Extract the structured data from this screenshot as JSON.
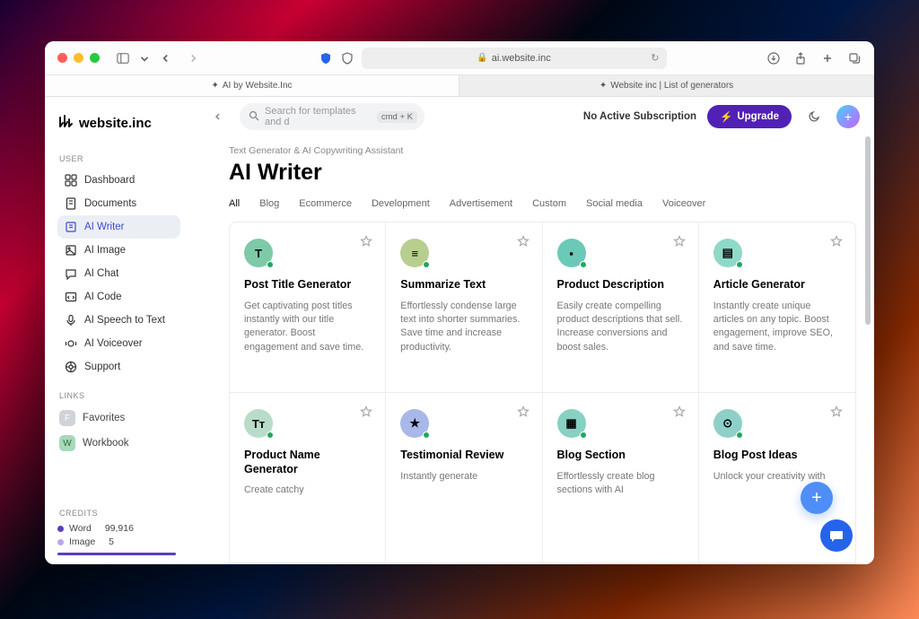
{
  "browser": {
    "url": "ai.website.inc",
    "tabs": [
      {
        "label": "AI by Website.Inc",
        "active": true
      },
      {
        "label": "Website inc | List of generators",
        "active": false
      }
    ]
  },
  "header": {
    "logo": "website.inc",
    "search_placeholder": "Search for templates and d",
    "search_kbd": "cmd + K",
    "subscription": "No Active Subscription",
    "upgrade": "Upgrade"
  },
  "sidebar": {
    "sections": {
      "user_label": "USER",
      "links_label": "LINKS",
      "credits_label": "CREDITS"
    },
    "user": [
      {
        "label": "Dashboard",
        "icon": "grid"
      },
      {
        "label": "Documents",
        "icon": "doc"
      },
      {
        "label": "AI Writer",
        "icon": "writer",
        "active": true
      },
      {
        "label": "AI Image",
        "icon": "image"
      },
      {
        "label": "AI Chat",
        "icon": "chat"
      },
      {
        "label": "AI Code",
        "icon": "code"
      },
      {
        "label": "AI Speech to Text",
        "icon": "mic"
      },
      {
        "label": "AI Voiceover",
        "icon": "voice"
      },
      {
        "label": "Support",
        "icon": "support"
      }
    ],
    "links": [
      {
        "label": "Favorites",
        "badge": "F"
      },
      {
        "label": "Workbook",
        "badge": "W"
      }
    ],
    "credits": [
      {
        "label": "Word",
        "value": "99,916",
        "color": "purple"
      },
      {
        "label": "Image",
        "value": "5",
        "color": "lav"
      }
    ]
  },
  "page": {
    "breadcrumb": "Text Generator & AI Copywriting Assistant",
    "title": "AI Writer",
    "filters": [
      "All",
      "Blog",
      "Ecommerce",
      "Development",
      "Advertisement",
      "Custom",
      "Social media",
      "Voiceover"
    ],
    "active_filter": "All",
    "cards": [
      {
        "title": "Post Title Generator",
        "desc": "Get captivating post titles instantly with our title generator. Boost engagement and save time.",
        "icon": "T",
        "bg": "#7dc9a8"
      },
      {
        "title": "Summarize Text",
        "desc": "Effortlessly condense large text into shorter summaries. Save time and increase productivity.",
        "icon": "≡",
        "bg": "#b8ce8e"
      },
      {
        "title": "Product Description",
        "desc": "Easily create compelling product descriptions that sell. Increase conversions and boost sales.",
        "icon": "▪",
        "bg": "#6bc9b8"
      },
      {
        "title": "Article Generator",
        "desc": "Instantly create unique articles on any topic. Boost engagement, improve SEO, and save time.",
        "icon": "▤",
        "bg": "#8fd9c9"
      },
      {
        "title": "Product Name Generator",
        "desc": "Create catchy",
        "icon": "Tᴛ",
        "bg": "#b8dcc8"
      },
      {
        "title": "Testimonial Review",
        "desc": "Instantly generate",
        "icon": "★",
        "bg": "#a8b8e8"
      },
      {
        "title": "Blog Section",
        "desc": "Effortlessly create blog sections with AI",
        "icon": "▦",
        "bg": "#88d0c2"
      },
      {
        "title": "Blog Post Ideas",
        "desc": "Unlock your creativity with",
        "icon": "⊙",
        "bg": "#8ed0c8"
      }
    ]
  }
}
